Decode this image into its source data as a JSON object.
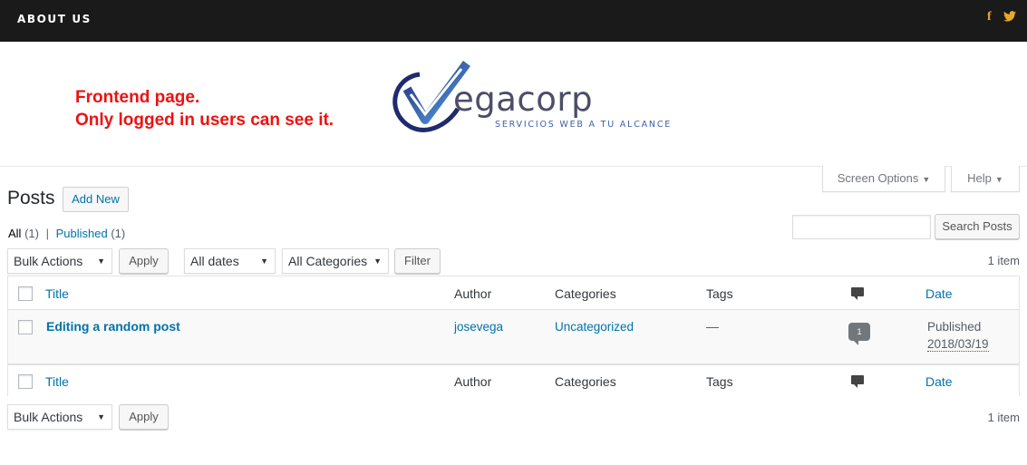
{
  "site": {
    "nav_about": "ABOUT US",
    "social": {
      "facebook": "f",
      "twitter": "🐦"
    },
    "notice_line1": "Frontend page.",
    "notice_line2": "Only logged in users can see it.",
    "logo_word": "egacorp",
    "logo_tagline": "SERVICIOS WEB A TU ALCANCE",
    "colors": {
      "topbar": "#1a1a1a",
      "social": "#e5a92f",
      "notice": "#ee1111",
      "link": "#0073aa"
    }
  },
  "screen_meta": {
    "screen_options": "Screen Options",
    "help": "Help"
  },
  "page": {
    "title": "Posts",
    "add_new": "Add New"
  },
  "subsubsub": {
    "all_label": "All",
    "all_count": "(1)",
    "separator": "|",
    "published_label": "Published",
    "published_count": "(1)"
  },
  "search": {
    "value": "",
    "button": "Search Posts"
  },
  "tablenav_top": {
    "bulk_actions": "Bulk Actions",
    "apply": "Apply",
    "dates": "All dates",
    "categories": "All Categories",
    "filter": "Filter",
    "items": "1 item"
  },
  "table": {
    "columns": {
      "title": "Title",
      "author": "Author",
      "categories": "Categories",
      "tags": "Tags",
      "comments_icon": "comment-icon",
      "date": "Date"
    },
    "rows": [
      {
        "title": "Editing a random post",
        "author": "josevega",
        "categories": "Uncategorized",
        "tags": "—",
        "comments": "1",
        "status": "Published",
        "date": "2018/03/19"
      }
    ]
  },
  "tablenav_bottom": {
    "bulk_actions": "Bulk Actions",
    "apply": "Apply",
    "items": "1 item"
  }
}
